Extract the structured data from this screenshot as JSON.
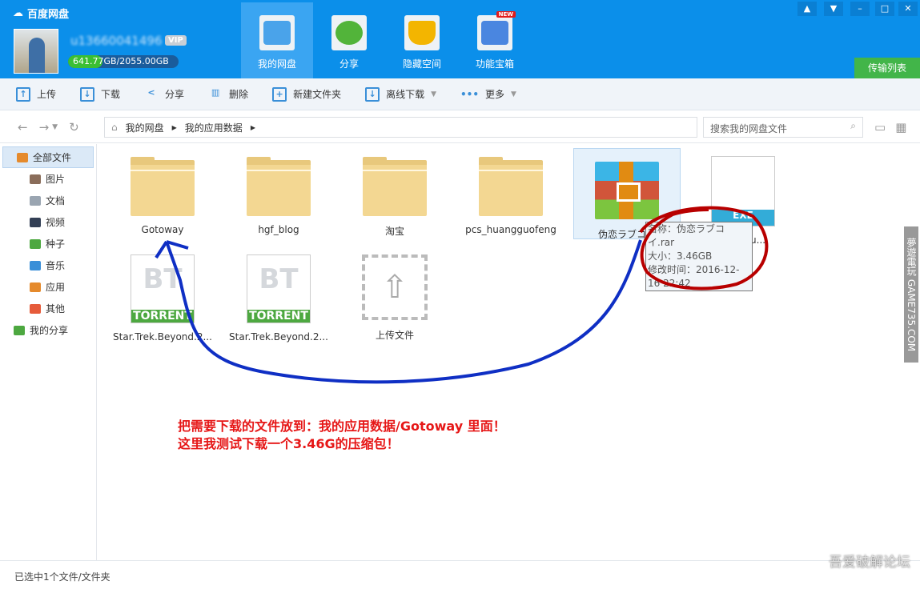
{
  "app": {
    "title": "百度网盘",
    "username": "u13660041496",
    "vip": "VIP",
    "quota_used": "641.77",
    "quota_text": "GB/2055.00GB",
    "quota_fraction": 0.312
  },
  "nav_tabs": [
    {
      "label": "我的网盘"
    },
    {
      "label": "分享"
    },
    {
      "label": "隐藏空间"
    },
    {
      "label": "功能宝箱",
      "badge": "NEW"
    }
  ],
  "transfer_list": "传输列表",
  "window_buttons": [
    "▲",
    "▼",
    "–",
    "□",
    "✕"
  ],
  "toolbar": [
    {
      "label": "上传",
      "icon": "↑"
    },
    {
      "label": "下载",
      "icon": "↓"
    },
    {
      "label": "分享",
      "icon": "<"
    },
    {
      "label": "删除",
      "icon": "▥"
    },
    {
      "label": "新建文件夹",
      "icon": "+"
    },
    {
      "label": "离线下载",
      "icon": "↓",
      "caret": "▼"
    },
    {
      "label": "更多",
      "icon": "•••",
      "caret": "▼"
    }
  ],
  "breadcrumb": [
    "我的网盘",
    "我的应用数据"
  ],
  "search": {
    "placeholder": "搜索我的网盘文件"
  },
  "sidebar": [
    {
      "label": "全部文件",
      "color": "#e58a2c"
    },
    {
      "label": "图片",
      "color": "#8a6d5a"
    },
    {
      "label": "文档",
      "color": "#9aa5b1"
    },
    {
      "label": "视频",
      "color": "#333f55"
    },
    {
      "label": "种子",
      "color": "#4da840"
    },
    {
      "label": "音乐",
      "color": "#3a8fd8"
    },
    {
      "label": "应用",
      "color": "#e58a2c"
    },
    {
      "label": "其他",
      "color": "#e65b3a"
    },
    {
      "label": "我的分享",
      "color": "#4da840"
    }
  ],
  "files": [
    {
      "name": "Gotoway",
      "type": "folder"
    },
    {
      "name": "hgf_blog",
      "type": "folder"
    },
    {
      "name": "淘宝",
      "type": "folder"
    },
    {
      "name": "pcs_huangguofeng",
      "type": "folder"
    },
    {
      "name": "伪恋ラブコイ",
      "type": "rar"
    },
    {
      "name": "..._Setu...",
      "type": "exe",
      "tag": "EXE"
    },
    {
      "name": "Star.Trek.Beyond.2...",
      "type": "torrent",
      "tag": "TORRENT",
      "glyph": "BT"
    },
    {
      "name": "Star.Trek.Beyond.2...",
      "type": "torrent",
      "tag": "TORRENT",
      "glyph": "BT"
    },
    {
      "name": "上传文件",
      "type": "upload"
    }
  ],
  "tooltip": {
    "name": "名称：伪恋ラブコイ.rar",
    "size": "大小：3.46GB",
    "modified": "修改时间：2016-12-16 22:42"
  },
  "annotation": {
    "line1": "把需要下载的文件放到：我的应用数据/Gotoway  里面！",
    "line2": "这里我测试下载一个3.46G的压缩包！"
  },
  "watermark": "夢遊電玩 GAME735.COM",
  "watermark2": "吾爱破解论坛",
  "status": "已选中1个文件/文件夹"
}
